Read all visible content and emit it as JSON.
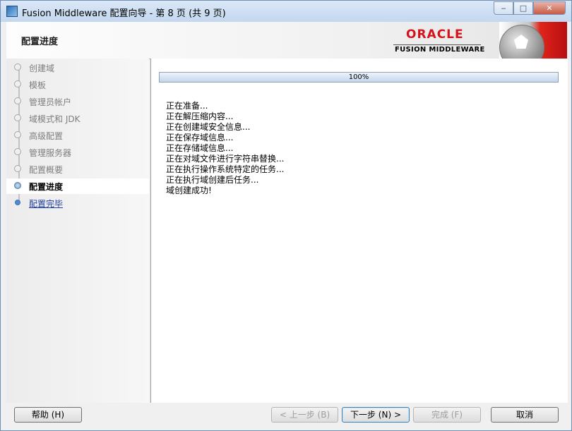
{
  "window": {
    "title": "Fusion Middleware 配置向导 - 第 8 页 (共 9 页)",
    "controls": {
      "minimize": "‒",
      "maximize": "□",
      "close": "✕"
    }
  },
  "header": {
    "page_title": "配置进度",
    "brand_top": "ORACLE",
    "brand_bottom": "FUSION MIDDLEWARE"
  },
  "nav": {
    "items": [
      {
        "label": "创建域",
        "state": "done"
      },
      {
        "label": "模板",
        "state": "done"
      },
      {
        "label": "管理员帐户",
        "state": "done"
      },
      {
        "label": "域模式和 JDK",
        "state": "done"
      },
      {
        "label": "高级配置",
        "state": "done"
      },
      {
        "label": "管理服务器",
        "state": "done"
      },
      {
        "label": "配置概要",
        "state": "done"
      },
      {
        "label": "配置进度",
        "state": "current"
      },
      {
        "label": "配置完毕",
        "state": "next"
      }
    ]
  },
  "progress": {
    "value": 100,
    "label": "100%"
  },
  "log": [
    "正在准备...",
    "正在解压缩内容...",
    "正在创建域安全信息...",
    "正在保存域信息...",
    "正在存储域信息...",
    "正在对域文件进行字符串替换...",
    "正在执行操作系统特定的任务...",
    "正在执行域创建后任务...",
    "域创建成功!"
  ],
  "buttons": {
    "help": "帮助 (H)",
    "back": "< 上一步 (B)",
    "next": "下一步 (N) >",
    "finish": "完成 (F)",
    "cancel": "取消"
  },
  "colors": {
    "oracle_red": "#d5121b",
    "link_blue": "#1d3fa1",
    "progress_border": "#8fa1b6"
  }
}
